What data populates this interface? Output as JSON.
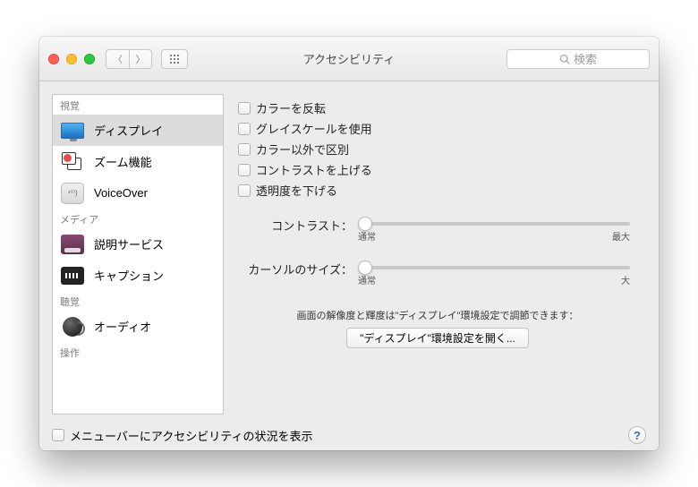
{
  "title": "アクセシビリティ",
  "search_placeholder": "検索",
  "sidebar": {
    "cat_vision": "視覚",
    "cat_media": "メディア",
    "cat_hearing": "聴覚",
    "cat_interact": "操作",
    "items": {
      "display": "ディスプレイ",
      "zoom": "ズーム機能",
      "voiceover": "VoiceOver",
      "descriptions": "説明サービス",
      "captions": "キャプション",
      "audio": "オーディオ"
    },
    "vo_small": "⁴⁰⁾)"
  },
  "checks": {
    "invert": "カラーを反転",
    "grayscale": "グレイスケールを使用",
    "diff": "カラー以外で区別",
    "contrast_up": "コントラストを上げる",
    "reduce_trans": "透明度を下げる"
  },
  "sliders": {
    "contrast_label": "コントラスト：",
    "contrast_min": "通常",
    "contrast_max": "最大",
    "cursor_label": "カーソルのサイズ：",
    "cursor_min": "通常",
    "cursor_max": "大"
  },
  "note": "画面の解像度と輝度は\"ディスプレイ\"環境設定で調節できます：",
  "open_button": "\"ディスプレイ\"環境設定を開く...",
  "footer_check": "メニューバーにアクセシビリティの状況を表示"
}
